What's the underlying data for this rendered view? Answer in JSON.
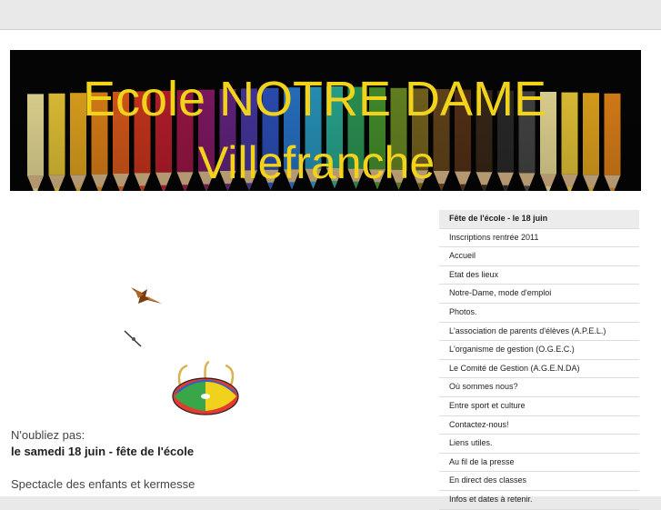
{
  "header": {
    "title_line1": "Ecole NOTRE DAME",
    "title_line2": "Villefranche"
  },
  "sidebar": {
    "items": [
      {
        "label": "Fête de l'école - le 18 juin",
        "active": true
      },
      {
        "label": "Inscriptions rentrée 2011"
      },
      {
        "label": "Accueil"
      },
      {
        "label": "Etat des lieux"
      },
      {
        "label": "Notre-Dame, mode d'emploi"
      },
      {
        "label": "Photos."
      },
      {
        "label": "L'association de parents d'élèves (A.P.E.L.)"
      },
      {
        "label": "L'organisme de gestion (O.G.E.C.)"
      },
      {
        "label": "Le Comité de Gestion (A.G.E.N.DA)"
      },
      {
        "label": "Où sommes nous?"
      },
      {
        "label": "Entre sport et culture"
      },
      {
        "label": "Contactez-nous!"
      },
      {
        "label": "Liens utiles."
      },
      {
        "label": "Au fil de la presse"
      },
      {
        "label": "En direct des classes"
      },
      {
        "label": "Infos et dates à retenir."
      }
    ]
  },
  "main": {
    "reminder": "N'oubliez pas:",
    "event_date": "le samedi 18 juin - fête de l'école",
    "event_description": "Spectacle des enfants et kermesse"
  },
  "decorations": [
    "butterfly-icon",
    "needle-icon",
    "carousel-icon"
  ],
  "colors": {
    "title_yellow": "#f2d31c",
    "header_background": "#050505",
    "active_item_background": "#ececec"
  }
}
